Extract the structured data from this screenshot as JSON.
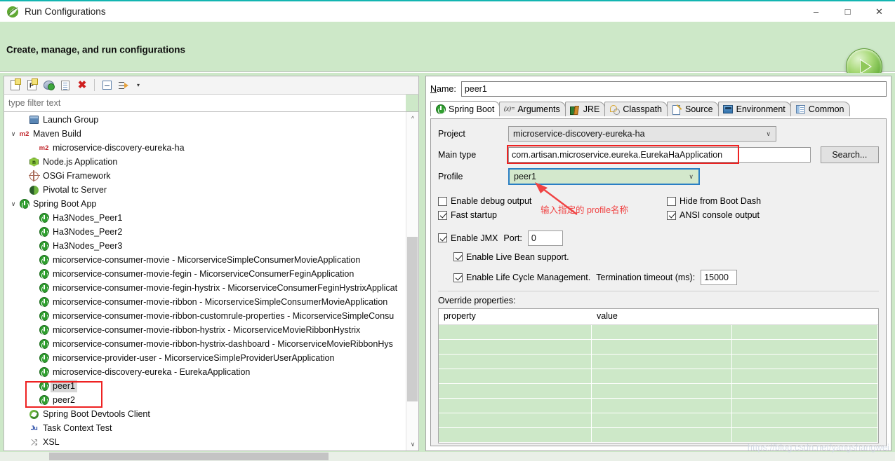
{
  "window": {
    "title": "Run Configurations",
    "icon": "spring-leaf-icon",
    "minimize": "–",
    "maximize": "□",
    "close": "✕"
  },
  "header": {
    "title": "Create, manage, and run configurations",
    "run_button": "run-button"
  },
  "toolbar": {
    "buttons": [
      {
        "name": "new-launch-configuration",
        "icon": "new-document-icon"
      },
      {
        "name": "new-prototype",
        "icon": "new-prototype-icon"
      },
      {
        "name": "export-prototype",
        "icon": "prototype-icon"
      },
      {
        "name": "duplicate-configuration",
        "icon": "duplicate-icon"
      },
      {
        "name": "delete-configuration",
        "icon": "delete-icon"
      },
      {
        "name": "collapse-all",
        "icon": "collapse-all-icon"
      },
      {
        "name": "filter-configurations",
        "icon": "filter-icon"
      }
    ],
    "dropdown_arrow": "▾"
  },
  "filter": {
    "placeholder": "type filter text",
    "value": ""
  },
  "tree": {
    "items": [
      {
        "label": "Launch Group",
        "icon": "launch-group-icon",
        "indent": 1,
        "twisty": "",
        "selected": false
      },
      {
        "label": "Maven Build",
        "icon": "m2-icon",
        "indent": 0,
        "twisty": "∨",
        "selected": false
      },
      {
        "label": "microservice-discovery-eureka-ha",
        "icon": "m2-icon",
        "indent": 2,
        "twisty": "",
        "selected": false
      },
      {
        "label": "Node.js Application",
        "icon": "nodejs-icon",
        "indent": 1,
        "twisty": "",
        "selected": false
      },
      {
        "label": "OSGi Framework",
        "icon": "osgi-icon",
        "indent": 1,
        "twisty": "",
        "selected": false
      },
      {
        "label": "Pivotal tc Server",
        "icon": "pivotal-icon",
        "indent": 1,
        "twisty": "",
        "selected": false
      },
      {
        "label": "Spring Boot App",
        "icon": "spring-boot-icon",
        "indent": 0,
        "twisty": "∨",
        "selected": false
      },
      {
        "label": "Ha3Nodes_Peer1",
        "icon": "spring-boot-icon",
        "indent": 2,
        "twisty": "",
        "selected": false
      },
      {
        "label": "Ha3Nodes_Peer2",
        "icon": "spring-boot-icon",
        "indent": 2,
        "twisty": "",
        "selected": false
      },
      {
        "label": "Ha3Nodes_Peer3",
        "icon": "spring-boot-icon",
        "indent": 2,
        "twisty": "",
        "selected": false
      },
      {
        "label": "micorservice-consumer-movie - MicorserviceSimpleConsumerMovieApplication",
        "icon": "spring-boot-icon",
        "indent": 2,
        "twisty": "",
        "selected": false
      },
      {
        "label": "micorservice-consumer-movie-fegin - MicorserviceConsumerFeginApplication",
        "icon": "spring-boot-icon",
        "indent": 2,
        "twisty": "",
        "selected": false
      },
      {
        "label": "micorservice-consumer-movie-fegin-hystrix - MicorserviceConsumerFeginHystrixApplicat",
        "icon": "spring-boot-icon",
        "indent": 2,
        "twisty": "",
        "selected": false
      },
      {
        "label": "micorservice-consumer-movie-ribbon - MicorserviceSimpleConsumerMovieApplication",
        "icon": "spring-boot-icon",
        "indent": 2,
        "twisty": "",
        "selected": false
      },
      {
        "label": "micorservice-consumer-movie-ribbon-customrule-properties - MicorserviceSimpleConsu",
        "icon": "spring-boot-icon",
        "indent": 2,
        "twisty": "",
        "selected": false
      },
      {
        "label": "micorservice-consumer-movie-ribbon-hystrix - MicorserviceMovieRibbonHystrix",
        "icon": "spring-boot-icon",
        "indent": 2,
        "twisty": "",
        "selected": false
      },
      {
        "label": "micorservice-consumer-movie-ribbon-hystrix-dashboard - MicorserviceMovieRibbonHys",
        "icon": "spring-boot-icon",
        "indent": 2,
        "twisty": "",
        "selected": false
      },
      {
        "label": "micorservice-provider-user - MicorserviceSimpleProviderUserApplication",
        "icon": "spring-boot-icon",
        "indent": 2,
        "twisty": "",
        "selected": false
      },
      {
        "label": "microservice-discovery-eureka - EurekaApplication",
        "icon": "spring-boot-icon",
        "indent": 2,
        "twisty": "",
        "selected": false
      },
      {
        "label": "peer1",
        "icon": "spring-boot-icon",
        "indent": 2,
        "twisty": "",
        "selected": true
      },
      {
        "label": "peer2",
        "icon": "spring-boot-icon",
        "indent": 2,
        "twisty": "",
        "selected": false
      },
      {
        "label": "Spring Boot Devtools Client",
        "icon": "devtools-icon",
        "indent": 1,
        "twisty": "",
        "selected": false
      },
      {
        "label": "Task Context Test",
        "icon": "junit-icon",
        "indent": 1,
        "twisty": "",
        "selected": false
      },
      {
        "label": "XSL",
        "icon": "xsl-icon",
        "indent": 1,
        "twisty": "",
        "selected": false
      }
    ]
  },
  "details": {
    "name_label": "Name:",
    "name_value": "peer1",
    "tabs": [
      {
        "label": "Spring Boot",
        "icon": "spring-boot-icon",
        "active": true
      },
      {
        "label": "Arguments",
        "icon": "arguments-icon",
        "active": false
      },
      {
        "label": "JRE",
        "icon": "jre-icon",
        "active": false
      },
      {
        "label": "Classpath",
        "icon": "classpath-icon",
        "active": false
      },
      {
        "label": "Source",
        "icon": "source-icon",
        "active": false
      },
      {
        "label": "Environment",
        "icon": "environment-icon",
        "active": false
      },
      {
        "label": "Common",
        "icon": "common-icon",
        "active": false
      }
    ],
    "project_label": "Project",
    "project_value": "microservice-discovery-eureka-ha",
    "main_type_label": "Main type",
    "main_type_value": "com.artisan.microservice.eureka.EurekaHaApplication",
    "search_label": "Search...",
    "profile_label": "Profile",
    "profile_value": "peer1",
    "checkboxes": [
      {
        "label": "Enable debug output",
        "checked": false
      },
      {
        "label": "Fast startup",
        "checked": true
      },
      {
        "label": "Hide from Boot Dash",
        "checked": false
      },
      {
        "label": "ANSI console output",
        "checked": true
      },
      {
        "label": "Enable JMX",
        "checked": true
      },
      {
        "label": "Enable Live Bean support.",
        "checked": true
      },
      {
        "label": "Enable Life Cycle Management.",
        "checked": true
      }
    ],
    "port_label": "Port:",
    "port_value": "0",
    "termination_label": "Termination timeout (ms):",
    "termination_value": "15000",
    "override_label": "Override properties:",
    "table": {
      "columns": [
        "property",
        "value",
        ""
      ],
      "rows": [
        [
          "",
          "",
          ""
        ],
        [
          "",
          "",
          ""
        ],
        [
          "",
          "",
          ""
        ],
        [
          "",
          "",
          ""
        ],
        [
          "",
          "",
          ""
        ],
        [
          "",
          "",
          ""
        ],
        [
          "",
          "",
          ""
        ],
        [
          "",
          "",
          ""
        ]
      ]
    }
  },
  "annotation": {
    "text": "输入指定的 profile名称",
    "color": "#f04343"
  },
  "watermark": "https://blog.csdn.net/yangshangwei",
  "colors": {
    "accent_teal": "#13b5b1",
    "header_green": "#cde8c8",
    "highlight_red": "#ee2222",
    "spring_green": "#2f9e2f"
  }
}
